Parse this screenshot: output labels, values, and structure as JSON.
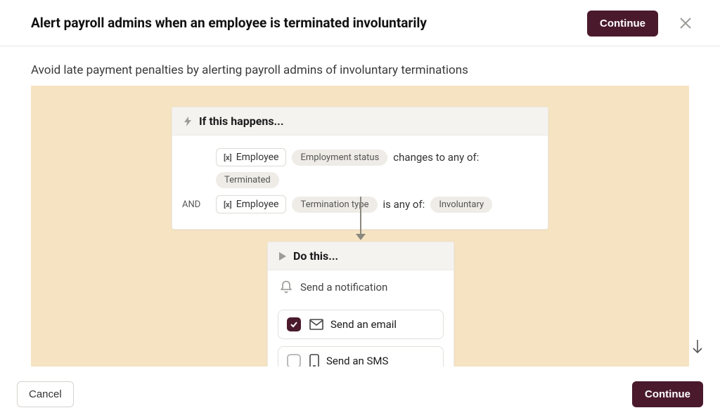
{
  "header": {
    "title": "Alert payroll admins when an employee is terminated involuntarily",
    "continue_label": "Continue"
  },
  "subtitle": "Avoid late payment penalties by alerting payroll admins of involuntary terminations",
  "trigger": {
    "header": "If this happens...",
    "and_label": "AND",
    "rows": [
      {
        "var_label": "Employee",
        "field": "Employment status",
        "op": "changes to any of:",
        "value": "Terminated"
      },
      {
        "var_label": "Employee",
        "field": "Termination type",
        "op": "is any of:",
        "value": "Involuntary"
      }
    ]
  },
  "action": {
    "header": "Do this...",
    "notification_label": "Send a notification",
    "channels": [
      {
        "label": "Send an email",
        "checked": true,
        "icon": "mail"
      },
      {
        "label": "Send an SMS",
        "checked": false,
        "icon": "phone"
      }
    ]
  },
  "footer": {
    "cancel_label": "Cancel",
    "continue_label": "Continue"
  }
}
